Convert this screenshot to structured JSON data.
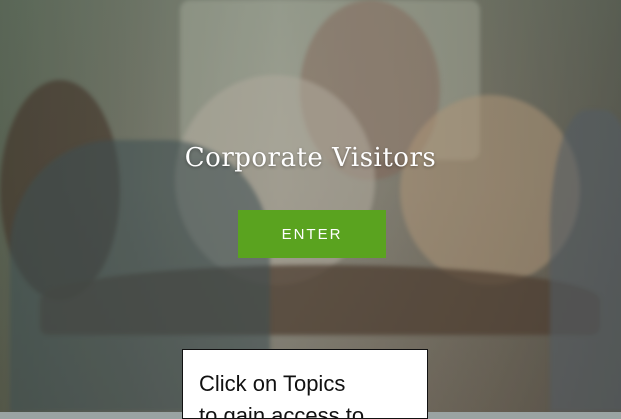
{
  "hero": {
    "title": "Corporate Visitors",
    "enter_label": "ENTER",
    "accent_color": "#5aa31f"
  },
  "callout": {
    "line1": "Click on Topics",
    "line2": "to gain access to"
  }
}
